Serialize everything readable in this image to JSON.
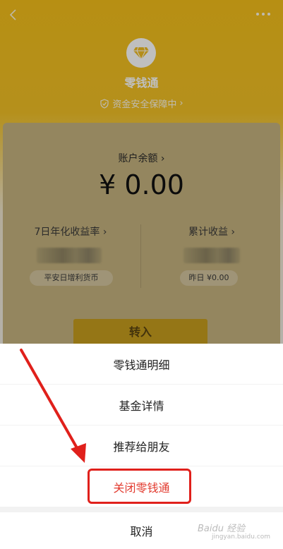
{
  "header": {
    "title": "零钱通",
    "security_text": "资金安全保障中"
  },
  "card": {
    "balance_label": "账户余额",
    "balance_value": "¥ 0.00",
    "left_col": {
      "label": "7日年化收益率",
      "pill": "平安日增利货币"
    },
    "right_col": {
      "label": "累计收益",
      "pill": "昨日 ¥0.00"
    },
    "transfer_button": "转入"
  },
  "action_sheet": {
    "items": [
      {
        "label": "零钱通明细"
      },
      {
        "label": "基金详情"
      },
      {
        "label": "推荐给朋友"
      },
      {
        "label": "关闭零钱通"
      }
    ],
    "cancel": "取消"
  },
  "watermark": {
    "brand": "Baidu 经验",
    "url": "jingyan.baidu.com"
  },
  "colors": {
    "header_yellow": "#f4bf1a",
    "danger_red": "#e23b2f",
    "annotation_red": "#e0201b"
  }
}
